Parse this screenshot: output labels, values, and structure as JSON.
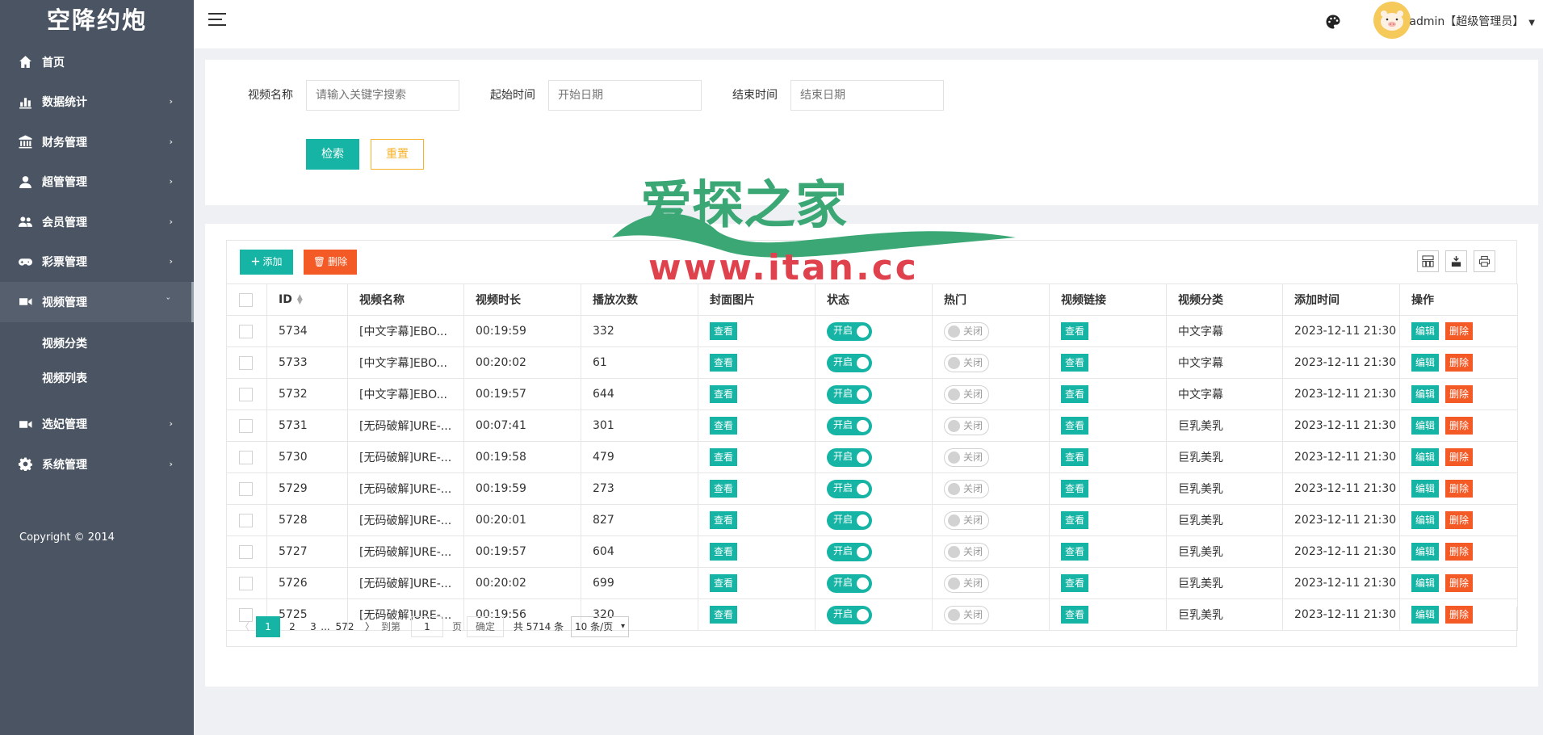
{
  "app": {
    "logo": "空降约炮"
  },
  "sidebar": {
    "items": [
      {
        "label": "首页",
        "icon": "home-icon"
      },
      {
        "label": "数据统计",
        "icon": "bar-chart-icon"
      },
      {
        "label": "财务管理",
        "icon": "bank-icon"
      },
      {
        "label": "超管管理",
        "icon": "user-icon"
      },
      {
        "label": "会员管理",
        "icon": "users-icon"
      },
      {
        "label": "彩票管理",
        "icon": "gamepad-icon"
      },
      {
        "label": "视频管理",
        "icon": "video-camera-icon"
      },
      {
        "label": "选妃管理",
        "icon": "video-camera-icon"
      },
      {
        "label": "系统管理",
        "icon": "gear-icon"
      }
    ],
    "sub_items": [
      "视频分类",
      "视频列表"
    ],
    "copyright": "Copyright © 2014"
  },
  "header": {
    "user": "admin【超级管理员】"
  },
  "search": {
    "video_name_label": "视频名称",
    "video_name_placeholder": "请输入关键字搜索",
    "start_label": "起始时间",
    "start_placeholder": "开始日期",
    "end_label": "结束时间",
    "end_placeholder": "结束日期",
    "search_btn": "检索",
    "reset_btn": "重置"
  },
  "watermark": {
    "text": "爱探之家",
    "url": "www.itan.cc"
  },
  "toolbar": {
    "add": "添加",
    "delete": "删除"
  },
  "table": {
    "headers": [
      "ID",
      "视频名称",
      "视频时长",
      "播放次数",
      "封面图片",
      "状态",
      "热门",
      "视频链接",
      "视频分类",
      "添加时间",
      "操作"
    ],
    "view_label": "查看",
    "on_label": "开启",
    "off_label": "关闭",
    "edit_label": "编辑",
    "remove_label": "删除",
    "rows": [
      {
        "id": "5734",
        "name": "[中文字幕]EBO...",
        "duration": "00:19:59",
        "plays": "332",
        "category": "中文字幕",
        "time": "2023-12-11 21:30"
      },
      {
        "id": "5733",
        "name": "[中文字幕]EBO...",
        "duration": "00:20:02",
        "plays": "61",
        "category": "中文字幕",
        "time": "2023-12-11 21:30"
      },
      {
        "id": "5732",
        "name": "[中文字幕]EBO...",
        "duration": "00:19:57",
        "plays": "644",
        "category": "中文字幕",
        "time": "2023-12-11 21:30"
      },
      {
        "id": "5731",
        "name": "[无码破解]URE-...",
        "duration": "00:07:41",
        "plays": "301",
        "category": "巨乳美乳",
        "time": "2023-12-11 21:30"
      },
      {
        "id": "5730",
        "name": "[无码破解]URE-...",
        "duration": "00:19:58",
        "plays": "479",
        "category": "巨乳美乳",
        "time": "2023-12-11 21:30"
      },
      {
        "id": "5729",
        "name": "[无码破解]URE-...",
        "duration": "00:19:59",
        "plays": "273",
        "category": "巨乳美乳",
        "time": "2023-12-11 21:30"
      },
      {
        "id": "5728",
        "name": "[无码破解]URE-...",
        "duration": "00:20:01",
        "plays": "827",
        "category": "巨乳美乳",
        "time": "2023-12-11 21:30"
      },
      {
        "id": "5727",
        "name": "[无码破解]URE-...",
        "duration": "00:19:57",
        "plays": "604",
        "category": "巨乳美乳",
        "time": "2023-12-11 21:30"
      },
      {
        "id": "5726",
        "name": "[无码破解]URE-...",
        "duration": "00:20:02",
        "plays": "699",
        "category": "巨乳美乳",
        "time": "2023-12-11 21:30"
      },
      {
        "id": "5725",
        "name": "[无码破解]URE-...",
        "duration": "00:19:56",
        "plays": "320",
        "category": "巨乳美乳",
        "time": "2023-12-11 21:30"
      }
    ]
  },
  "pagination": {
    "pages": [
      "1",
      "2",
      "3"
    ],
    "ellipsis": "...",
    "last": "572",
    "goto_label": "到第",
    "goto_value": "1",
    "page_unit": "页",
    "confirm": "确定",
    "total": "共 5714 条",
    "page_size": "10 条/页"
  },
  "colors": {
    "accent": "#16b4a4",
    "danger": "#f45a25",
    "warning": "#f7b22a",
    "sidebar": "#4a5462"
  }
}
